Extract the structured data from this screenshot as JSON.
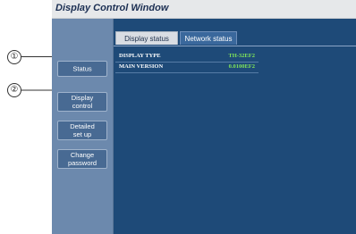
{
  "window": {
    "title": "Display Control Window"
  },
  "sidebar": {
    "items": [
      {
        "label": "Status"
      },
      {
        "label": "Display\ncontrol"
      },
      {
        "label": "Detailed\nset up"
      },
      {
        "label": "Change\npassword"
      }
    ]
  },
  "tabs": [
    {
      "label": "Display status"
    },
    {
      "label": "Network status"
    }
  ],
  "status": {
    "rows": [
      {
        "label": "DISPLAY TYPE",
        "value": "TH-32EF2"
      },
      {
        "label": "MAIN VERSION",
        "value": "0.0100EF2"
      }
    ]
  },
  "callouts": [
    "①",
    "②"
  ]
}
